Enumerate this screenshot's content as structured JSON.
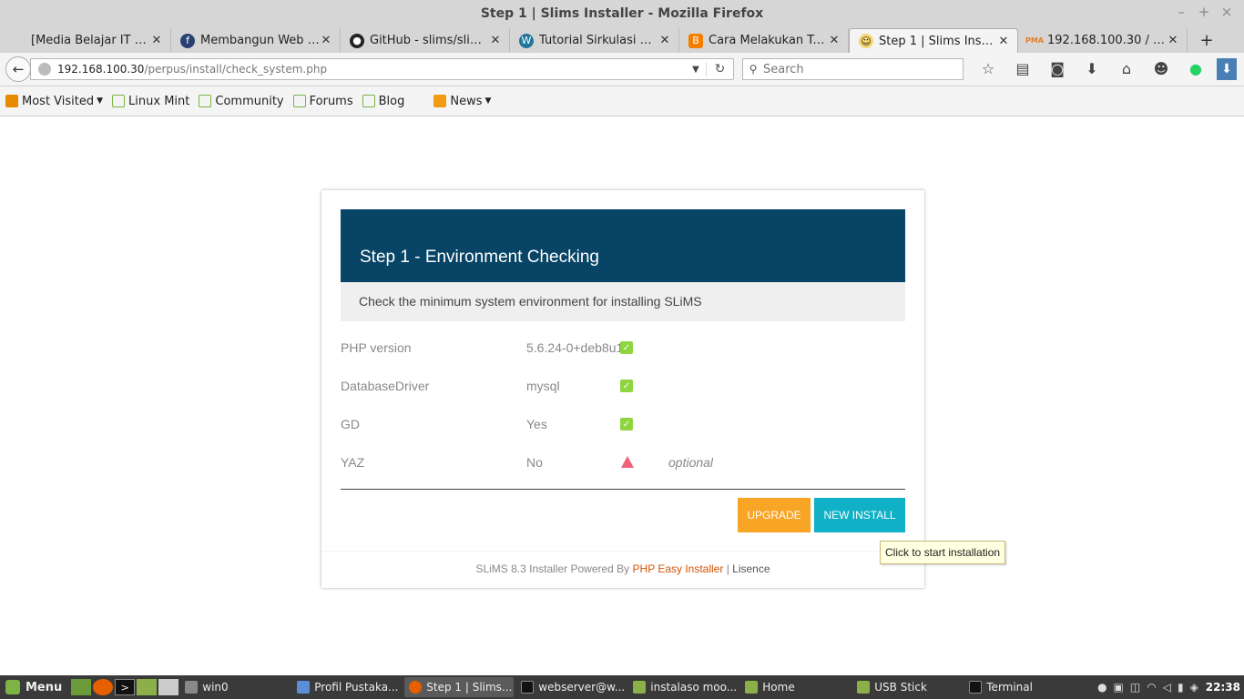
{
  "window": {
    "title": "Step 1 | Slims Installer - Mozilla Firefox"
  },
  "tabs": [
    {
      "label": "[Media Belajar IT Siswa ...",
      "icon": "blank-page-icon"
    },
    {
      "label": "Membangun Web Pe...",
      "icon": "fedora-icon"
    },
    {
      "label": "GitHub - slims/slims...",
      "icon": "github-icon"
    },
    {
      "label": "Tutorial Sirkulasi De...",
      "icon": "wordpress-icon"
    },
    {
      "label": "Cara Melakukan Tra...",
      "icon": "blogger-icon"
    },
    {
      "label": "Step 1 | Slims Installer",
      "icon": "slims-icon",
      "active": true
    },
    {
      "label": "192.168.100.30 / loc...",
      "icon": "phpmyadmin-icon"
    }
  ],
  "navbar": {
    "url_host": "192.168.100.30",
    "url_path": "/perpus/install/check_system.php",
    "search_placeholder": "Search"
  },
  "bookmarks": [
    {
      "label": "Most Visited",
      "dropdown": true,
      "icon": "most-visited-icon"
    },
    {
      "label": "Linux Mint",
      "icon": "mint-bookmark-icon"
    },
    {
      "label": "Community",
      "icon": "mint-bookmark-icon"
    },
    {
      "label": "Forums",
      "icon": "mint-bookmark-icon"
    },
    {
      "label": "Blog",
      "icon": "mint-bookmark-icon"
    },
    {
      "label": "News",
      "dropdown": true,
      "icon": "rss-icon"
    }
  ],
  "installer": {
    "title": "Step 1 - Environment Checking",
    "subtitle": "Check the minimum system environment for installing SLiMS",
    "checks": [
      {
        "name": "PHP version",
        "value": "5.6.24-0+deb8u1",
        "status": "ok",
        "note": ""
      },
      {
        "name": "DatabaseDriver",
        "value": "mysql",
        "status": "ok",
        "note": ""
      },
      {
        "name": "GD",
        "value": "Yes",
        "status": "ok",
        "note": ""
      },
      {
        "name": "YAZ",
        "value": "No",
        "status": "warning",
        "note": "optional"
      }
    ],
    "upgrade_label": "UPGRADE",
    "install_label": "NEW INSTALL",
    "tooltip": "Click to start installation",
    "footer_prefix": "SLiMS 8.3 Installer Powered By",
    "footer_link": "PHP Easy Installer",
    "footer_sep": "|",
    "footer_license": "Lisence"
  },
  "taskbar": {
    "menu_label": "Menu",
    "tasks": [
      {
        "label": "win0",
        "icon": "gear-icon"
      },
      {
        "label": "Profil Pustaka...",
        "icon": "browser-icon"
      },
      {
        "label": "Step 1 | Slims...",
        "icon": "firefox-icon",
        "active": true
      },
      {
        "label": "webserver@w...",
        "icon": "terminal-icon"
      },
      {
        "label": "instalaso moo...",
        "icon": "folder-icon"
      },
      {
        "label": "Home",
        "icon": "folder-icon"
      },
      {
        "label": "USB Stick",
        "icon": "folder-icon"
      },
      {
        "label": "Terminal",
        "icon": "terminal-icon"
      }
    ],
    "clock": "22:38"
  },
  "colors": {
    "header_bg": "#074466",
    "upgrade_bg": "#f8a425",
    "install_bg": "#10b1c7",
    "ok": "#8ed53f",
    "warning": "#f0617a"
  }
}
